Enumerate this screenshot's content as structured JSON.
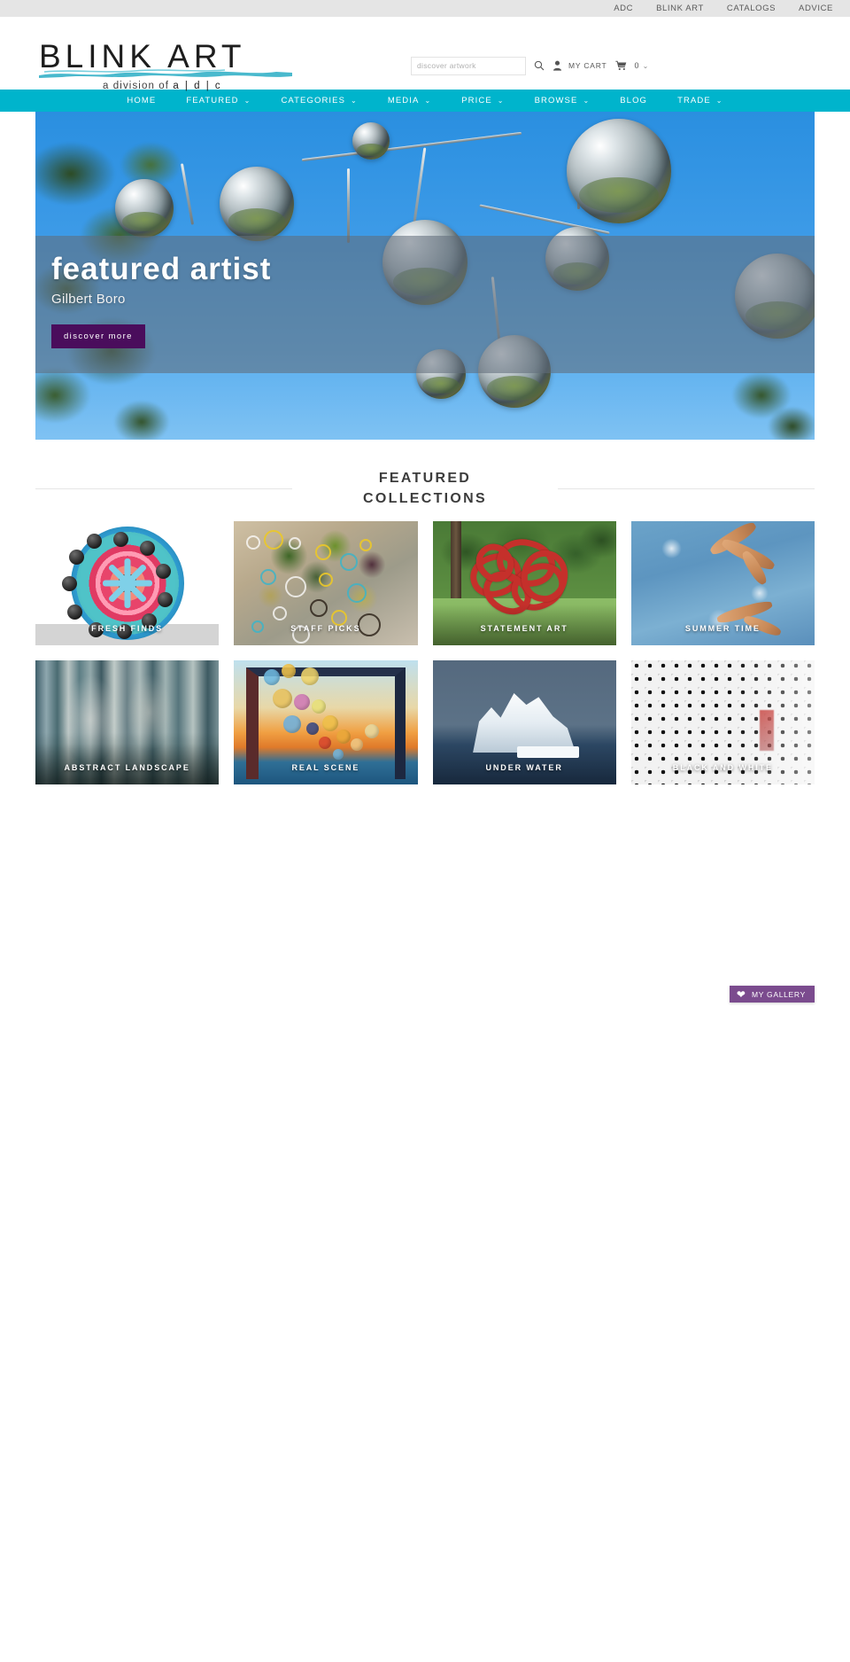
{
  "utility_nav": {
    "items": [
      {
        "label": "ADC"
      },
      {
        "label": "BLINK ART"
      },
      {
        "label": "CATALOGS"
      },
      {
        "label": "ADVICE"
      }
    ]
  },
  "header": {
    "logo": {
      "wordmark": "BLINK ART",
      "tagline_prefix": "a division of",
      "tagline_brand": "a | d | c"
    },
    "search": {
      "placeholder": "discover artwork",
      "value": ""
    },
    "cart": {
      "label": "MY  CART",
      "count": "0"
    },
    "icons": {
      "search": "search-icon",
      "account": "user-icon",
      "cart": "cart-icon",
      "caret": "chevron-down-icon"
    }
  },
  "main_nav": {
    "items": [
      {
        "label": "HOME",
        "has_dropdown": false
      },
      {
        "label": "FEATURED",
        "has_dropdown": true
      },
      {
        "label": "CATEGORIES",
        "has_dropdown": true
      },
      {
        "label": "MEDIA",
        "has_dropdown": true
      },
      {
        "label": "PRICE",
        "has_dropdown": true
      },
      {
        "label": "BROWSE",
        "has_dropdown": true
      },
      {
        "label": "BLOG",
        "has_dropdown": false
      },
      {
        "label": "TRADE",
        "has_dropdown": true
      }
    ]
  },
  "hero": {
    "title": "featured artist",
    "subtitle": "Gilbert Boro",
    "cta_label": "discover more",
    "cta_color": "#4a0d5c"
  },
  "featured_collections": {
    "heading_line1": "FEATURED",
    "heading_line2": "COLLECTIONS",
    "tiles": [
      {
        "label": "FRESH FINDS"
      },
      {
        "label": "STAFF PICKS"
      },
      {
        "label": "STATEMENT ART"
      },
      {
        "label": "SUMMER TIME"
      },
      {
        "label": "ABSTRACT LANDSCAPE"
      },
      {
        "label": "REAL SCENE"
      },
      {
        "label": "UNDER WATER"
      },
      {
        "label": "BLACK AND WHITE"
      }
    ]
  },
  "gallery_tab": {
    "label": "MY GALLERY",
    "icon": "heart-icon",
    "color": "#7b4b8e"
  },
  "theme": {
    "nav_bar": "#00b4cc",
    "utility_bar": "#e5e5e5",
    "accent_purple": "#4a0d5c"
  }
}
